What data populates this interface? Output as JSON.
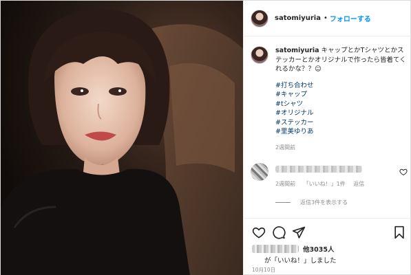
{
  "header": {
    "username": "satomiyuria",
    "separator": "•",
    "follow_label": "フォローする"
  },
  "caption": {
    "username": "satomiyuria",
    "text": "キャップとかTシャツとかステッカーとかオリジナルで作ったら皆着てくれるかな？？☺",
    "hashtags": [
      "#打ち合わせ",
      "#キャップ",
      "#tシャツ",
      "#オリジナル",
      "#ステッカー",
      "#里美ゆりあ"
    ],
    "time": "2週間前"
  },
  "comment": {
    "time": "2週間前",
    "likes": "「いいね！」1件",
    "reply_label": "返信"
  },
  "replies": {
    "label": "返信3件を表示する"
  },
  "likes": {
    "count_text": "他3035人",
    "suffix": "が「いいね！」しました"
  },
  "date": "10月10日",
  "icons": {
    "like": "heart-icon",
    "comment": "comment-icon",
    "share": "share-icon",
    "save": "bookmark-icon"
  },
  "colors": {
    "accent_blue": "#0095f6",
    "hashtag": "#00376b",
    "muted": "#8e8e8e"
  }
}
